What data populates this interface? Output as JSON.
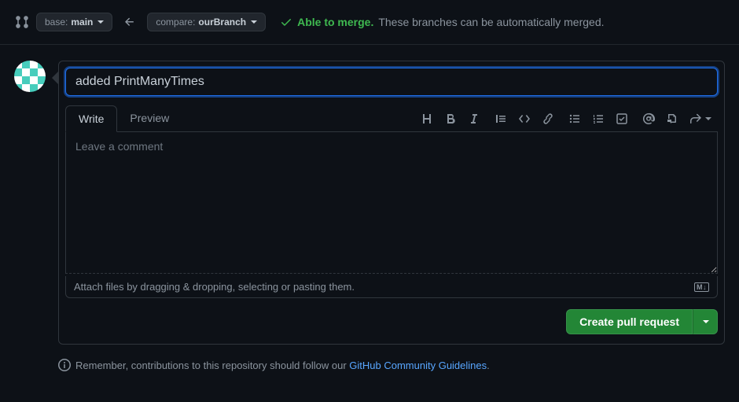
{
  "topbar": {
    "base_label": "base: ",
    "base_value": "main",
    "compare_label": "compare: ",
    "compare_value": "ourBranch",
    "merge_ok": "Able to merge.",
    "merge_text": "These branches can be automatically merged."
  },
  "pr": {
    "title_value": "added PrintManyTimes",
    "tabs": {
      "write": "Write",
      "preview": "Preview"
    },
    "comment_placeholder": "Leave a comment",
    "attach_text": "Attach files by dragging & dropping, selecting or pasting them.",
    "create_button": "Create pull request"
  },
  "footer": {
    "text_before": "Remember, contributions to this repository should follow our ",
    "link": "GitHub Community Guidelines",
    "text_after": "."
  }
}
